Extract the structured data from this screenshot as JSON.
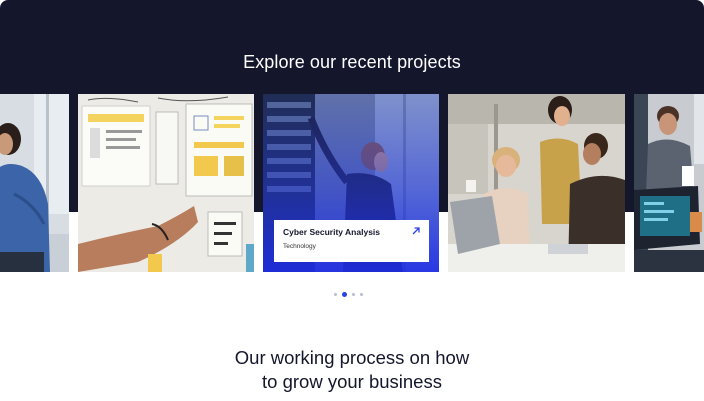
{
  "projects": {
    "title": "Explore our recent projects",
    "featured": {
      "name": "Cyber Security Analysis",
      "category": "Technology"
    },
    "cards": [
      {
        "image": "woman-reading-notes"
      },
      {
        "image": "sticky-notes-wireframes"
      },
      {
        "image": "server-room-technician"
      },
      {
        "image": "team-meeting-laptops"
      },
      {
        "image": "man-with-laptop"
      }
    ],
    "pagination": {
      "count": 4,
      "active_index": 1
    },
    "colors": {
      "dark": "#14172c",
      "accent": "#2a41e8",
      "dot": "#b9bdd0"
    }
  },
  "process": {
    "title_line1": "Our working process on how",
    "title_line2": "to grow your business"
  }
}
